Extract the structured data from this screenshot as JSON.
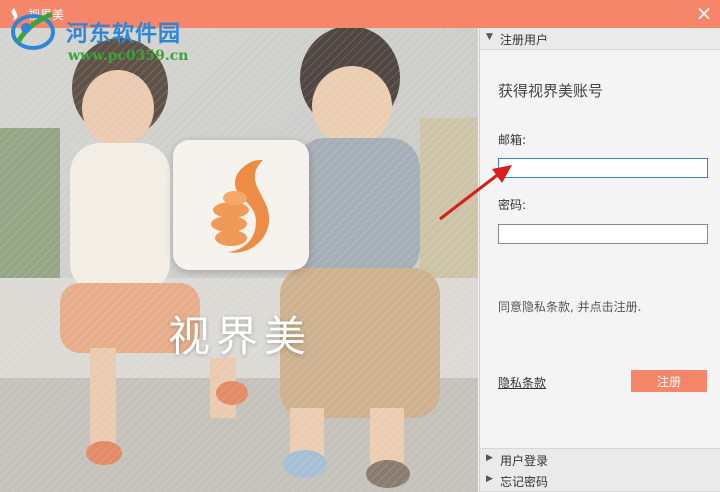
{
  "window": {
    "title": "视界美",
    "close_glyph": "×"
  },
  "watermark": {
    "title": "河东软件园",
    "url": "www.pc0359.cn"
  },
  "hero": {
    "brand_text": "视界美"
  },
  "panel": {
    "register_section": {
      "arrow": "▼",
      "label": "注册用户"
    },
    "heading": "获得视界美账号",
    "email": {
      "label": "邮箱:",
      "value": "",
      "placeholder": ""
    },
    "password": {
      "label": "密码:",
      "value": "",
      "placeholder": ""
    },
    "agree_text": "同意隐私条款, 并点击注册.",
    "privacy_link": "隐私条款",
    "register_button": "注册",
    "login_section": {
      "arrow": "▶",
      "label": "用户登录"
    },
    "forgot_section": {
      "arrow": "▶",
      "label": "忘记密码"
    }
  },
  "colors": {
    "accent": "#f5866a",
    "focus_border": "#3c7fd0",
    "annotation_arrow": "#d62020"
  }
}
